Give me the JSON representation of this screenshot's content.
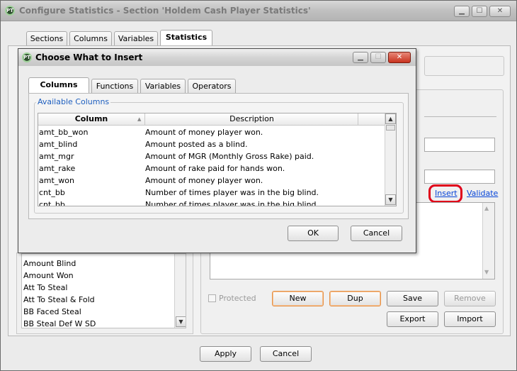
{
  "outer": {
    "title": "Configure Statistics - Section 'Holdem Cash Player Statistics'",
    "app_icon": "PT",
    "tabs": [
      {
        "label": "Sections",
        "selected": false
      },
      {
        "label": "Columns",
        "selected": false
      },
      {
        "label": "Variables",
        "selected": false
      },
      {
        "label": "Statistics",
        "selected": true
      }
    ],
    "stat_list": [
      "Amount Blind",
      "Amount Won",
      "Att To Steal",
      "Att To Steal & Fold",
      "BB Faced Steal",
      "BB Steal Def W SD"
    ],
    "insert_link": "Insert",
    "validate_link": "Validate",
    "protected_label": "Protected",
    "buttons": {
      "new": "New",
      "dup": "Dup",
      "save": "Save",
      "remove": "Remove",
      "export": "Export",
      "import": "Import",
      "apply": "Apply",
      "cancel": "Cancel"
    },
    "highlight_color": "#e0001a"
  },
  "dialog": {
    "title": "Choose What to Insert",
    "app_icon": "PT",
    "tabs": [
      {
        "label": "Columns",
        "selected": true
      },
      {
        "label": "Functions",
        "selected": false
      },
      {
        "label": "Variables",
        "selected": false
      },
      {
        "label": "Operators",
        "selected": false
      }
    ],
    "group_label": "Available Columns",
    "table": {
      "headers": {
        "column": "Column",
        "description": "Description"
      },
      "rows": [
        {
          "column": "amt_bb_won",
          "description": "Amount of money player won."
        },
        {
          "column": "amt_blind",
          "description": "Amount posted as a blind."
        },
        {
          "column": "amt_mgr",
          "description": "Amount of MGR (Monthly Gross Rake) paid."
        },
        {
          "column": "amt_rake",
          "description": "Amount of rake paid for hands won."
        },
        {
          "column": "amt_won",
          "description": "Amount of money player won."
        },
        {
          "column": "cnt_bb",
          "description": "Number of times player was in the big blind."
        },
        {
          "column": "cnt_bb",
          "description": "Number of times player was in the big blind."
        }
      ]
    },
    "ok_label": "OK",
    "cancel_label": "Cancel"
  }
}
